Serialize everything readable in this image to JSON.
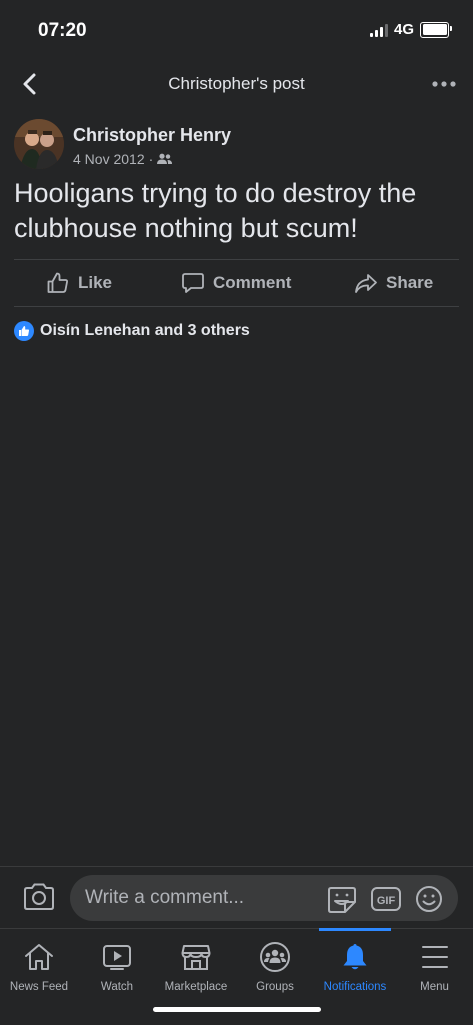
{
  "status_bar": {
    "time": "07:20",
    "network": "4G"
  },
  "header": {
    "title": "Christopher's post",
    "back_icon": "chevron-left-icon",
    "more_icon": "more-horizontal-icon"
  },
  "post": {
    "author": "Christopher Henry",
    "date": "4 Nov 2012",
    "separator": "·",
    "audience_icon": "friends-icon",
    "text": "Hooligans trying to do destroy the clubhouse nothing but scum!"
  },
  "actions": {
    "like": "Like",
    "comment": "Comment",
    "share": "Share"
  },
  "reactions": {
    "summary": "Oisín Lenehan and 3 others",
    "icon": "like-reaction-icon"
  },
  "comment_bar": {
    "placeholder": "Write a comment...",
    "gif_label": "GIF"
  },
  "tabs": [
    {
      "label": "News Feed",
      "icon": "home-icon"
    },
    {
      "label": "Watch",
      "icon": "video-icon"
    },
    {
      "label": "Marketplace",
      "icon": "shop-icon"
    },
    {
      "label": "Groups",
      "icon": "groups-icon"
    },
    {
      "label": "Notifications",
      "icon": "bell-icon",
      "active": true
    },
    {
      "label": "Menu",
      "icon": "menu-icon"
    }
  ],
  "colors": {
    "background": "#242526",
    "text_primary": "#e4e6eb",
    "text_secondary": "#b0b3b8",
    "accent": "#2d88ff"
  }
}
